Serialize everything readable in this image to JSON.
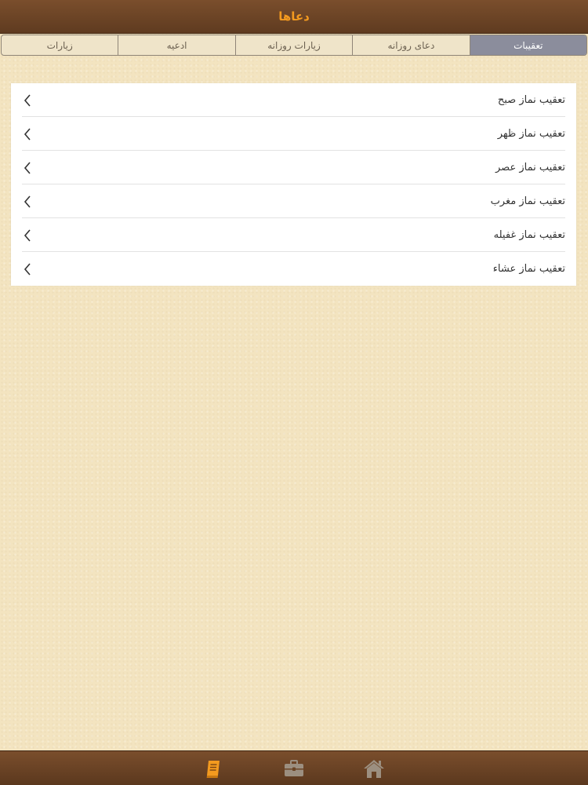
{
  "header": {
    "title": "دعاها"
  },
  "tabs": [
    {
      "label": "تعقیبات",
      "active": true
    },
    {
      "label": "دعای روزانه",
      "active": false
    },
    {
      "label": "زیارات روزانه",
      "active": false
    },
    {
      "label": "ادعیه",
      "active": false
    },
    {
      "label": "زیارات",
      "active": false
    }
  ],
  "list": {
    "items": [
      {
        "label": "تعقیب نماز صبح"
      },
      {
        "label": "تعقیب نماز ظهر"
      },
      {
        "label": "تعقیب نماز عصر"
      },
      {
        "label": "تعقیب نماز مغرب"
      },
      {
        "label": "تعقیب نماز غفیله"
      },
      {
        "label": "تعقیب نماز عشاء"
      }
    ]
  },
  "bottom_bar": {
    "items": [
      {
        "icon": "book-icon",
        "active": true
      },
      {
        "icon": "briefcase-icon",
        "active": false
      },
      {
        "icon": "home-icon",
        "active": false
      }
    ]
  },
  "colors": {
    "accent": "#f39a1f",
    "bar_brown": "#6b4526",
    "active_tab": "#8b8d9c",
    "background": "#f3e4c0",
    "inactive_icon": "#9c8f80"
  }
}
